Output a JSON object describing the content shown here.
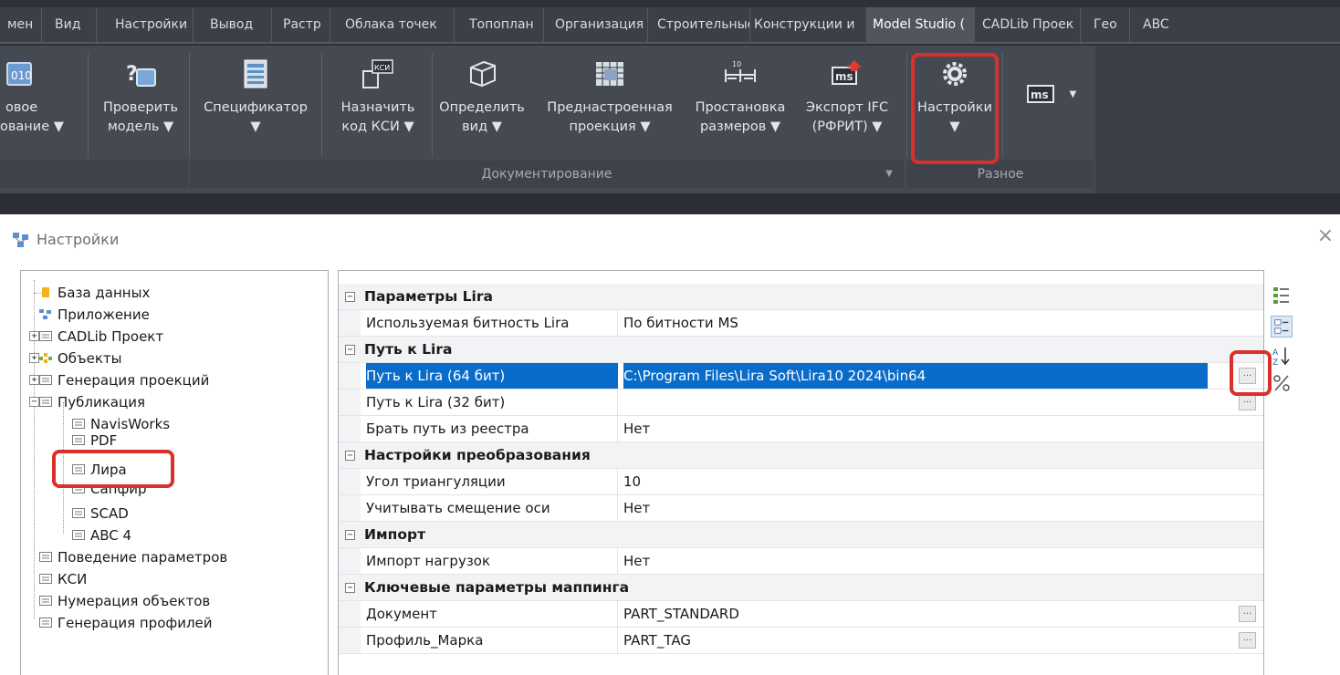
{
  "ribbon": {
    "tabs": [
      "мен",
      "Вид",
      "Настройки",
      "Вывод",
      "Растр",
      "Облака точек",
      "Топоплан",
      "Организация",
      "Строительные",
      "Конструкции и",
      "Model Studio (",
      "CADLib Проек",
      "Гео",
      "ABC"
    ],
    "active_tab": "Model Studio (",
    "buttons": [
      {
        "label1": "овое",
        "label2": "ование ▼",
        "icon": "numbering-icon"
      },
      {
        "label1": "Проверить",
        "label2": "модель ▼",
        "icon": "check-model-icon"
      },
      {
        "label1": "Спецификатор",
        "label2": "▼",
        "icon": "specifier-icon"
      },
      {
        "label1": "Назначить",
        "label2": "код КСИ ▼",
        "icon": "assign-ksi-icon"
      },
      {
        "label1": "Определить",
        "label2": "вид ▼",
        "icon": "define-view-icon"
      },
      {
        "label1": "Преднастроенная",
        "label2": "проекция ▼",
        "icon": "preset-projection-icon"
      },
      {
        "label1": "Простановка",
        "label2": "размеров ▼",
        "icon": "dimensioning-icon"
      },
      {
        "label1": "Экспорт IFC",
        "label2": "(РФРИТ) ▼",
        "icon": "export-ifc-icon"
      },
      {
        "label1": "Настройки",
        "label2": "▼",
        "icon": "settings-gear-icon"
      },
      {
        "label1": "",
        "label2": "",
        "icon": "ms-icon"
      }
    ],
    "icon_glyphs": {
      "ksi": "КСИ",
      "ms": "ms"
    },
    "groups": {
      "documenting": "Документирование",
      "misc": "Разное"
    },
    "highlight_color": "#d9302a"
  },
  "dialog": {
    "title": "Настройки",
    "close": "×",
    "tree": [
      {
        "label": "База данных",
        "icon": "database-icon"
      },
      {
        "label": "Приложение",
        "icon": "application-icon"
      },
      {
        "label": "CADLib Проект",
        "icon": "list-icon",
        "toggle": "+"
      },
      {
        "label": "Объекты",
        "icon": "objects-icon",
        "toggle": "+"
      },
      {
        "label": "Генерация проекций",
        "icon": "list-icon",
        "toggle": "+"
      },
      {
        "label": "Публикация",
        "icon": "list-icon",
        "toggle": "−"
      },
      {
        "label": "NavisWorks",
        "icon": "list-icon"
      },
      {
        "label": "PDF",
        "icon": "list-icon"
      },
      {
        "label": "Лира",
        "icon": "list-icon"
      },
      {
        "label": "Сапфир",
        "icon": "list-icon"
      },
      {
        "label": "SCAD",
        "icon": "list-icon"
      },
      {
        "label": "ABC 4",
        "icon": "list-icon"
      },
      {
        "label": "Поведение параметров",
        "icon": "list-icon"
      },
      {
        "label": "КСИ",
        "icon": "list-icon"
      },
      {
        "label": "Нумерация объектов",
        "icon": "list-icon"
      },
      {
        "label": "Генерация профилей",
        "icon": "list-icon"
      }
    ],
    "grid": {
      "toggle": "−",
      "ellipsis": "...",
      "categories": [
        {
          "title": "Параметры Lira",
          "rows": [
            {
              "name": "Используемая битность Lira",
              "value": "По битности MS"
            }
          ]
        },
        {
          "title": "Путь к Lira",
          "rows": [
            {
              "name": "Путь к Lira (64 бит)",
              "value": "C:\\Program Files\\Lira Soft\\Lira10 2024\\bin64"
            },
            {
              "name": "Путь к Lira (32 бит)",
              "value": ""
            },
            {
              "name": "Брать путь из реестра",
              "value": "Нет"
            }
          ]
        },
        {
          "title": "Настройки преобразования",
          "rows": [
            {
              "name": "Угол триангуляции",
              "value": "10"
            },
            {
              "name": "Учитывать смещение оси",
              "value": "Нет"
            }
          ]
        },
        {
          "title": "Импорт",
          "rows": [
            {
              "name": "Импорт нагрузок",
              "value": "Нет"
            }
          ]
        },
        {
          "title": "Ключевые параметры маппинга",
          "rows": [
            {
              "name": "Документ",
              "value": "PART_STANDARD"
            },
            {
              "name": "Профиль_Марка",
              "value": "PART_TAG"
            }
          ]
        }
      ]
    },
    "side_tools": [
      "categorized-icon",
      "alphabetical-icon",
      "sort-az-icon",
      "property-pages-icon"
    ],
    "sort_glyph": "A↓Z",
    "selection_color": "#0a6cc9"
  }
}
